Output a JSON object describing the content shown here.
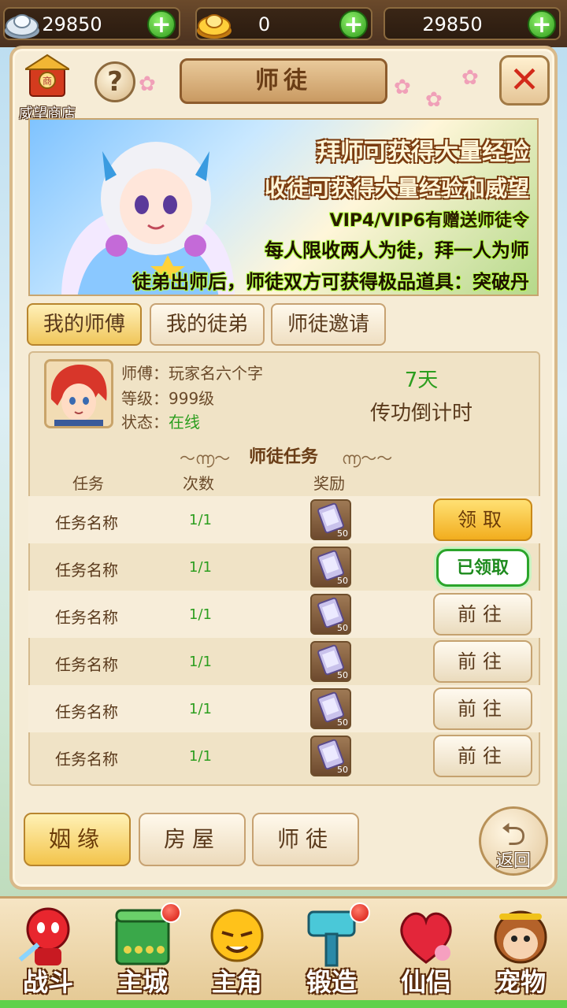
{
  "currencies": [
    {
      "icon": "silver-ingot-icon",
      "value": "29850"
    },
    {
      "icon": "gold-ingot-icon",
      "value": "0"
    },
    {
      "icon": "",
      "value": "29850"
    }
  ],
  "header": {
    "title": "师徒",
    "shop_label": "威望商店",
    "help": "?",
    "close": "✕"
  },
  "banner": {
    "line1": "拜师可获得大量经验",
    "line2": "收徒可获得大量经验和威望",
    "line3": "VIP4/VIP6有赠送师徒令",
    "line4": "每人限收两人为徒，拜一人为师",
    "line5": "徒弟出师后，师徒双方可获得极品道具：突破丹"
  },
  "tabs": [
    "我的师傅",
    "我的徒弟",
    "师徒邀请"
  ],
  "master": {
    "name_label": "师傅：",
    "name": "玩家名六个字",
    "level_label": "等级：",
    "level": "999级",
    "status_label": "状态：",
    "status": "在线",
    "days": "7天",
    "countdown_label": "传功倒计时"
  },
  "tasks_section": {
    "title": "师徒任务",
    "columns": [
      "任务",
      "次数",
      "奖励"
    ]
  },
  "tasks": [
    {
      "name": "任务名称",
      "count": "1/1",
      "reward_qty": "50",
      "action": "领取",
      "state": "claim"
    },
    {
      "name": "任务名称",
      "count": "1/1",
      "reward_qty": "50",
      "action": "已领取",
      "state": "done"
    },
    {
      "name": "任务名称",
      "count": "1/1",
      "reward_qty": "50",
      "action": "前往",
      "state": "goto"
    },
    {
      "name": "任务名称",
      "count": "1/1",
      "reward_qty": "50",
      "action": "前往",
      "state": "goto"
    },
    {
      "name": "任务名称",
      "count": "1/1",
      "reward_qty": "50",
      "action": "前往",
      "state": "goto"
    },
    {
      "name": "任务名称",
      "count": "1/1",
      "reward_qty": "50",
      "action": "前往",
      "state": "goto"
    }
  ],
  "bottom_tabs": [
    "姻缘",
    "房屋",
    "师徒"
  ],
  "back_label": "返回",
  "nav": [
    {
      "label": "战斗",
      "icon": "battle-icon",
      "badge": false
    },
    {
      "label": "主城",
      "icon": "main-city-icon",
      "badge": true
    },
    {
      "label": "主角",
      "icon": "hero-icon",
      "badge": false
    },
    {
      "label": "锻造",
      "icon": "forge-icon",
      "badge": true
    },
    {
      "label": "仙侣",
      "icon": "partner-icon",
      "badge": false
    },
    {
      "label": "宠物",
      "icon": "pet-icon",
      "badge": false
    }
  ],
  "colors": {
    "accent_gold": "#f2ad1e",
    "green": "#2c9e1f",
    "brown": "#5a3a1c"
  }
}
